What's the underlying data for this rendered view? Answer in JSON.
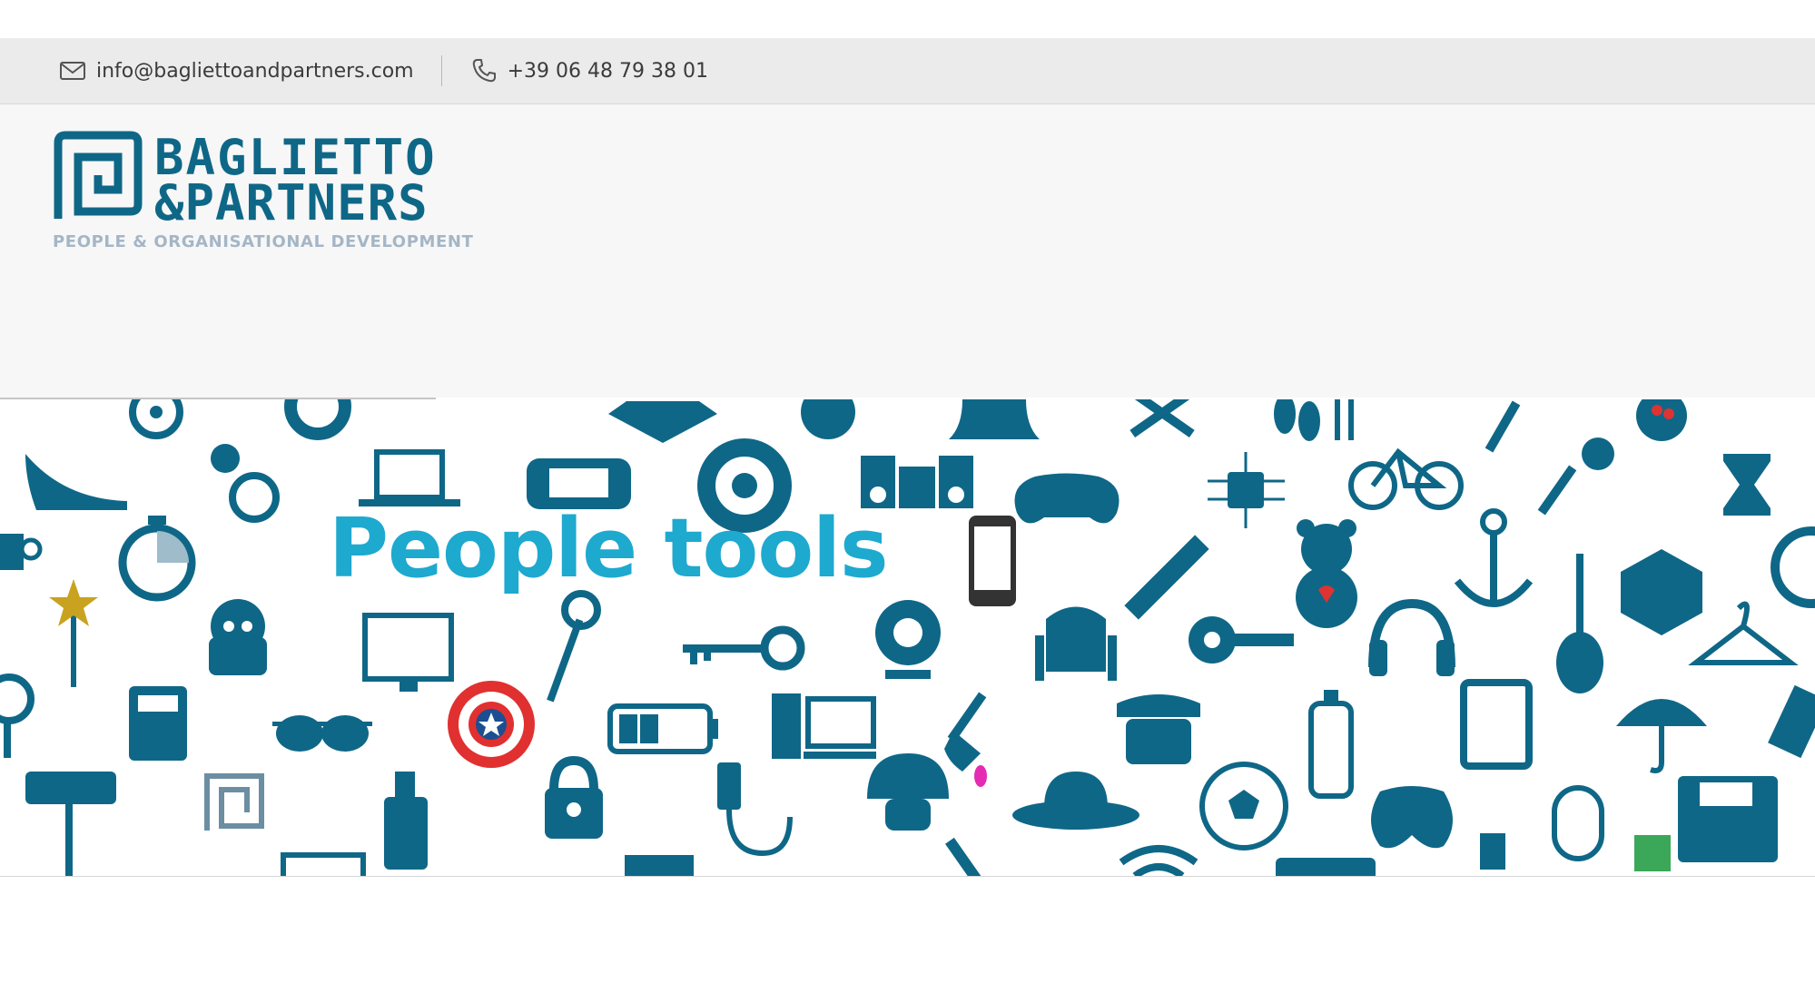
{
  "topbar": {
    "email": "info@bagliettoandpartners.com",
    "email_icon": "envelope-icon",
    "phone": "+39 06 48 79 38 01",
    "phone_icon": "phone-icon"
  },
  "logo": {
    "line1": "BAGLIETTO",
    "line2": "&PARTNERS",
    "tagline": "PEOPLE & ORGANISATIONAL DEVELOPMENT"
  },
  "slider": {
    "progress_fraction": 0.24
  },
  "banner": {
    "title": "People tools"
  },
  "colors": {
    "brand_teal": "#0f6787",
    "title_blue": "#1ea9cf",
    "tagline_grey": "#a4b6c6"
  }
}
